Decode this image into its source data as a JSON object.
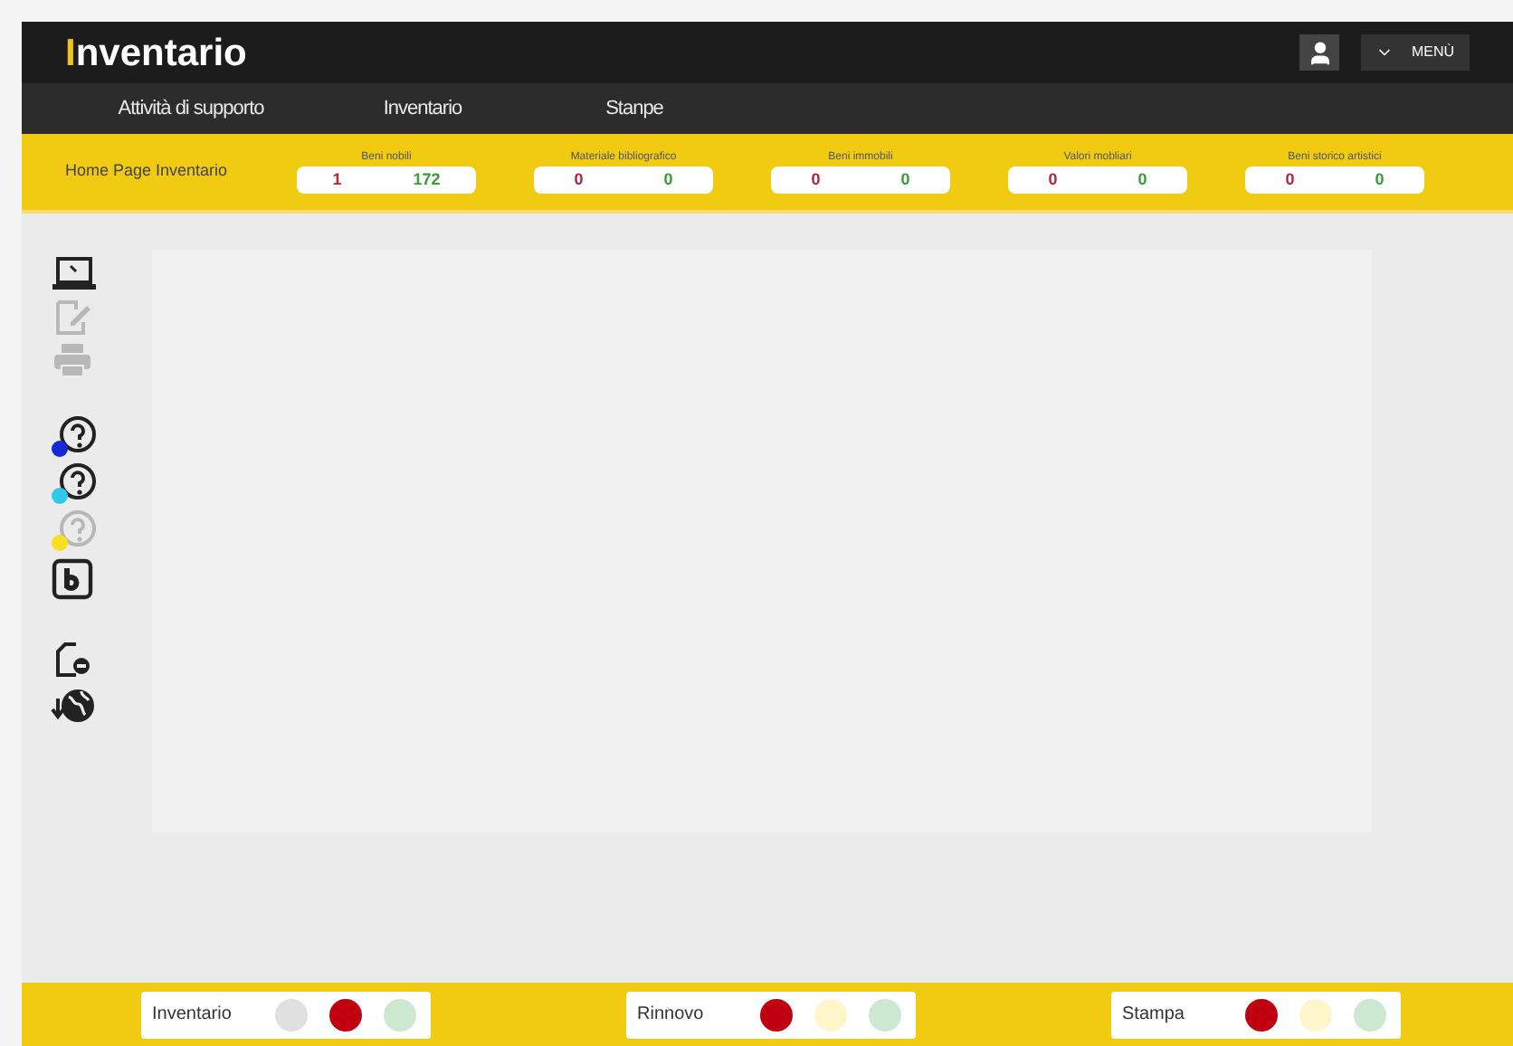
{
  "header": {
    "logo_mark": "I",
    "logo_text": "nventario",
    "menu_label": "MENÙ"
  },
  "nav": [
    {
      "label": "Attività di supporto"
    },
    {
      "label": "Inventario"
    },
    {
      "label": "Stanpe"
    }
  ],
  "summary": {
    "title": "Home Page Inventario",
    "counters": [
      {
        "label": "Beni nobili",
        "red": "1",
        "green": "172"
      },
      {
        "label": "Materiale bibliografico",
        "red": "0",
        "green": "0"
      },
      {
        "label": "Beni immobili",
        "red": "0",
        "green": "0"
      },
      {
        "label": "Valori mobliari",
        "red": "0",
        "green": "0"
      },
      {
        "label": "Beni storico artistici",
        "red": "0",
        "green": "0"
      }
    ]
  },
  "tools": [
    [
      {
        "kind": "laptop",
        "disabled": false
      },
      {
        "kind": "edit",
        "disabled": true
      },
      {
        "kind": "print",
        "disabled": true
      }
    ],
    [
      {
        "kind": "help",
        "disabled": false,
        "color": "#1428d8"
      },
      {
        "kind": "help",
        "disabled": false,
        "color": "#30c8e8"
      },
      {
        "kind": "help",
        "disabled": true,
        "color": "#f8e020"
      },
      {
        "kind": "b",
        "disabled": false
      }
    ],
    [
      {
        "kind": "file",
        "disabled": false
      },
      {
        "kind": "globe",
        "disabled": false
      }
    ]
  ],
  "status": [
    {
      "label": "Inventario",
      "lights": [
        {
          "color": "#e0e0e0"
        },
        {
          "color": "#c00010"
        },
        {
          "color": "#cce8d0"
        }
      ]
    },
    {
      "label": "Rinnovo",
      "lights": [
        {
          "color": "#c00010"
        },
        {
          "color": "#fff6cc"
        },
        {
          "color": "#cce8d0"
        }
      ]
    },
    {
      "label": "Stampa",
      "lights": [
        {
          "color": "#c00010"
        },
        {
          "color": "#fff6cc"
        },
        {
          "color": "#cce8d0"
        }
      ]
    }
  ]
}
